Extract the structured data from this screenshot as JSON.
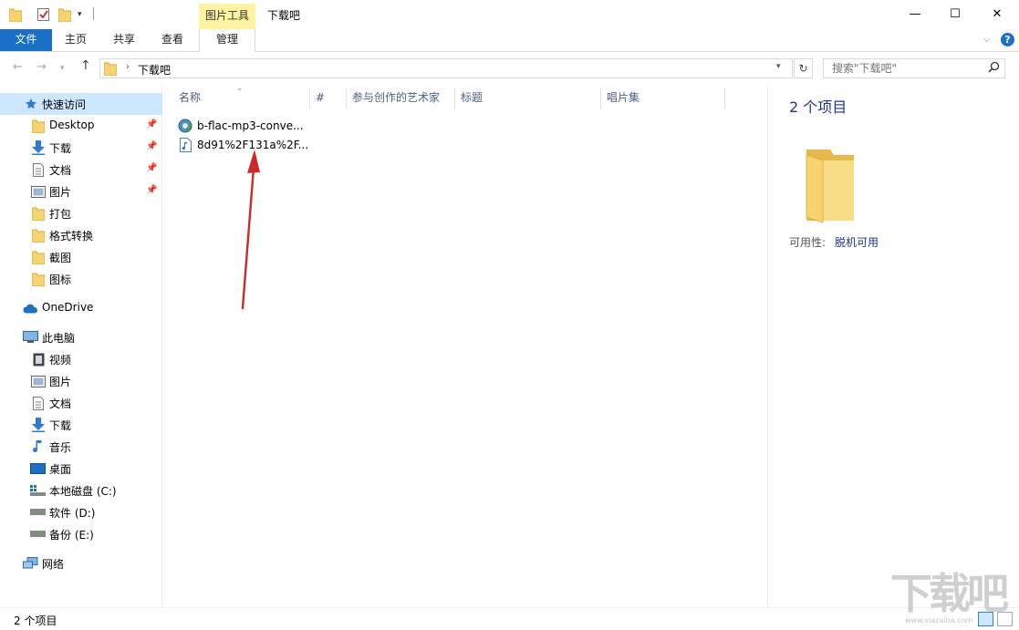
{
  "window": {
    "title": "下载吧",
    "context_tab_group": "图片工具",
    "minimize_glyph": "—",
    "maximize_glyph": "☐",
    "close_glyph": "✕"
  },
  "ribbon": {
    "tabs": [
      {
        "label": "文件"
      },
      {
        "label": "主页"
      },
      {
        "label": "共享"
      },
      {
        "label": "查看"
      },
      {
        "label": "管理"
      }
    ],
    "help_glyph": "?",
    "collapse_glyph": "⌵"
  },
  "address": {
    "path": "下载吧",
    "search_placeholder": "搜索\"下载吧\""
  },
  "nav_pane": {
    "quick_access": "快速访问",
    "quick_items": [
      {
        "label": "Desktop",
        "icon": "folder-icon",
        "pinned": true
      },
      {
        "label": "下载",
        "icon": "download-icon",
        "pinned": true
      },
      {
        "label": "文档",
        "icon": "document-icon",
        "pinned": true
      },
      {
        "label": "图片",
        "icon": "picture-icon",
        "pinned": true
      },
      {
        "label": "打包",
        "icon": "folder-icon",
        "pinned": false
      },
      {
        "label": "格式转换",
        "icon": "folder-icon",
        "pinned": false
      },
      {
        "label": "截图",
        "icon": "folder-icon",
        "pinned": false
      },
      {
        "label": "图标",
        "icon": "folder-icon",
        "pinned": false
      }
    ],
    "onedrive": "OneDrive",
    "this_pc": "此电脑",
    "pc_items": [
      {
        "label": "视频",
        "icon": "video-icon"
      },
      {
        "label": "图片",
        "icon": "picture-icon"
      },
      {
        "label": "文档",
        "icon": "document-icon"
      },
      {
        "label": "下载",
        "icon": "download-icon"
      },
      {
        "label": "音乐",
        "icon": "music-icon"
      },
      {
        "label": "桌面",
        "icon": "desktop-icon"
      },
      {
        "label": "本地磁盘 (C:)",
        "icon": "system-drive-icon"
      },
      {
        "label": "软件 (D:)",
        "icon": "drive-icon"
      },
      {
        "label": "备份 (E:)",
        "icon": "drive-icon"
      }
    ],
    "network": "网络"
  },
  "file_list": {
    "columns": [
      "名称",
      "#",
      "参与创作的艺术家",
      "标题",
      "唱片集"
    ],
    "files": [
      {
        "name": "b-flac-mp3-conve...",
        "icon": "app-icon"
      },
      {
        "name": "8d91%2F131a%2F...",
        "icon": "audio-file-icon"
      }
    ]
  },
  "preview": {
    "count": "2 个项目",
    "availability_label": "可用性:",
    "availability_value": "脱机可用"
  },
  "status": {
    "count": "2 个项目"
  },
  "watermark": {
    "text": "下载吧",
    "sub": "www.xiazaiba.com"
  },
  "colors": {
    "accent": "#1a6fc6",
    "selected_bg": "#cce8ff",
    "context_tab": "#fdf3a0",
    "arrow": "#cc2a2a",
    "folder": "#f6d36f"
  }
}
